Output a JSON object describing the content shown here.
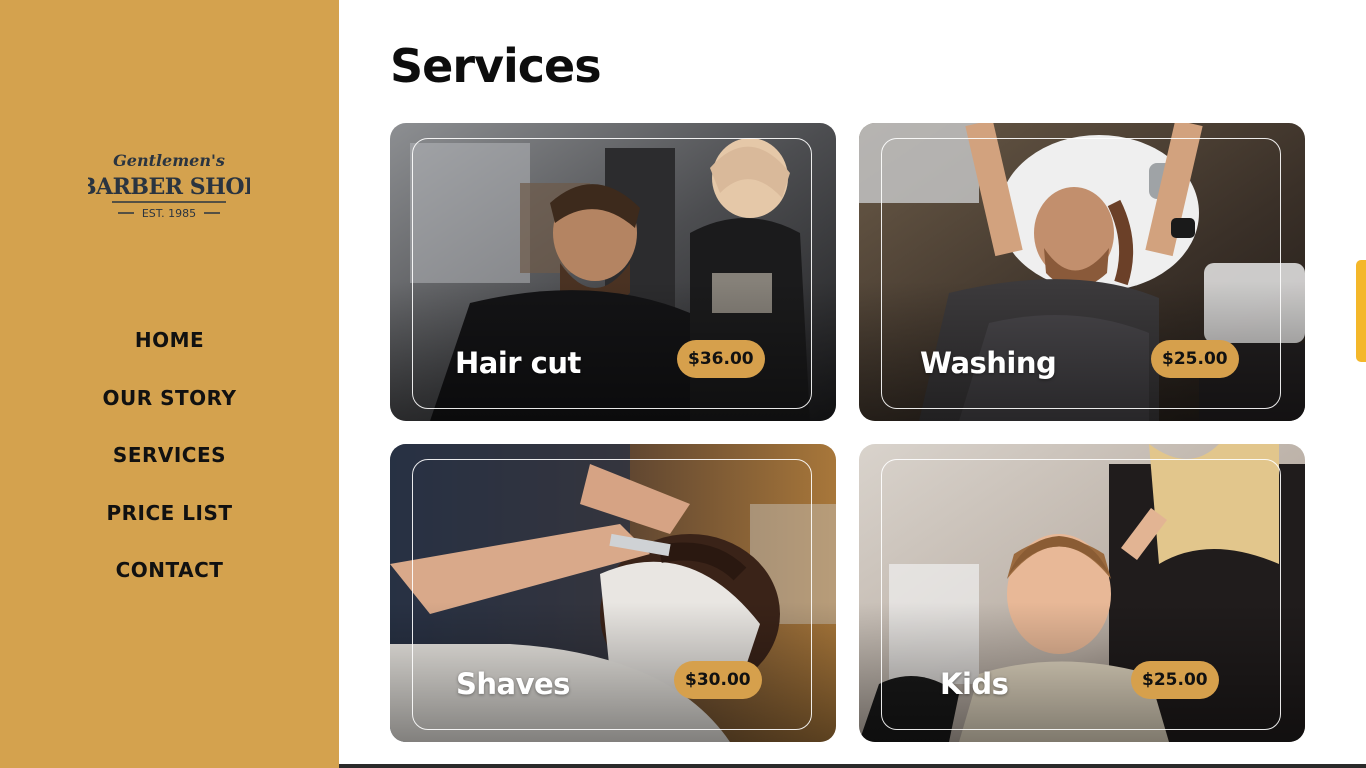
{
  "brand": {
    "logo_line1": "Gentlemen's",
    "logo_line2": "BARBER SHOP",
    "logo_line3": "EST. 1985",
    "logo_color": "#2a3440",
    "sidebar_color": "#d4a24e"
  },
  "nav": {
    "items": [
      {
        "label": "HOME"
      },
      {
        "label": "OUR STORY"
      },
      {
        "label": "SERVICES"
      },
      {
        "label": "PRICE LIST"
      },
      {
        "label": "CONTACT"
      }
    ]
  },
  "main": {
    "title": "Services",
    "services": [
      {
        "name": "Hair cut",
        "price": "$36.00"
      },
      {
        "name": "Washing",
        "price": "$25.00"
      },
      {
        "name": "Shaves",
        "price": "$30.00"
      },
      {
        "name": "Kids",
        "price": "$25.00"
      }
    ],
    "price_badge_color": "#d6a04c",
    "accent_color": "#f4b72a"
  }
}
